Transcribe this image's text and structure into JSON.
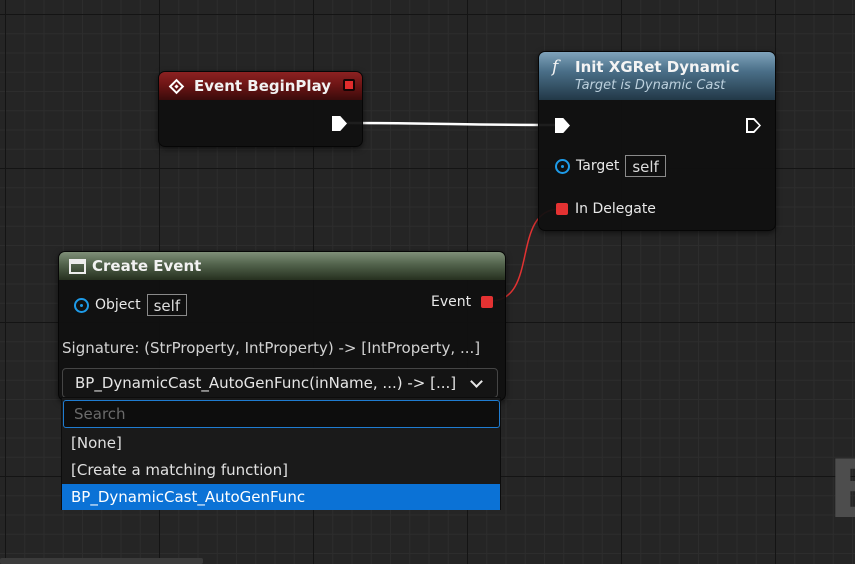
{
  "nodes": {
    "begin_play": {
      "title": "Event BeginPlay"
    },
    "init": {
      "icon": "f",
      "title": "Init XGRet Dynamic",
      "subtitle": "Target is Dynamic Cast",
      "target_label": "Target",
      "target_value": "self",
      "delegate_label": "In Delegate"
    },
    "create_event": {
      "title": "Create Event",
      "object_label": "Object",
      "object_value": "self",
      "event_label": "Event",
      "signature": "Signature: (StrProperty, IntProperty) -> [IntProperty, ...]",
      "selected_function": "BP_DynamicCast_AutoGenFunc(inName, ...) -> [...]"
    }
  },
  "popup": {
    "search_placeholder": "Search",
    "items": [
      {
        "label": "[None]"
      },
      {
        "label": "[Create a matching function]"
      },
      {
        "label": "BP_DynamicCast_AutoGenFunc"
      }
    ]
  },
  "edge_text": "B",
  "colors": {
    "exec_wire": "#ffffff",
    "delegate_wire": "#e13232",
    "object_pin": "#1e9be8",
    "selection": "#0b72d6",
    "event_header": "#7a1a1a",
    "function_header": "#4a6f88",
    "create_event_header": "#51624b"
  }
}
